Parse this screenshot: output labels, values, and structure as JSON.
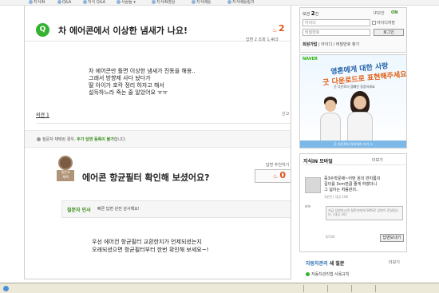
{
  "topnav": {
    "items": [
      "지식iN",
      "Q&A",
      "지식 Q&A",
      "사람들 ▾",
      "지식iN영상",
      "지식배틀",
      "지식배틀링크"
    ]
  },
  "question": {
    "badge": "Q",
    "title": "차 에어콘에서 이상한 냄새가 나요!",
    "score": "2",
    "stats": "답변 2   조회 1,403",
    "body": [
      "차 에어콘만 틀면 이상한 냄새가 진동을 해용..",
      "그래서 방향제 사다 놨다가",
      "딸 아이가 호칵 정리 하자고 해서",
      "설득하느라 죽는 줄 알았어요 ㅠㅠ"
    ],
    "opinion_link": "의견 1",
    "report_link": "신고",
    "notice_text": "질문자 채택된 경우,",
    "notice_bold": "추가 답변 등록이 불가",
    "notice_end": "합니다."
  },
  "answer": {
    "medal_label": "질문자\n채택",
    "title": "에어콘 항균필터 확인해 보셨어요?",
    "rec_label": "답변 추천하기",
    "rec_count": "0",
    "thanks_label": "질문자 인사",
    "thanks_text": "빠른 답변 완전 감사해요!",
    "body": [
      "우선 에어컨 항균필터 교환한지가 언제되셨는지",
      "오래되셨으면 항균필터부터 한번 확인해 보세요~!"
    ]
  },
  "login": {
    "stats_prefix": "보관",
    "stats_count": "2",
    "stats_unit": "건",
    "ip_label": "IP보안",
    "ip_state": "ON",
    "id_placeholder": "아이디",
    "pw_placeholder": "비밀번호",
    "save_id": "아이디저장",
    "login_button": "로그인",
    "join": "회원가입",
    "find": "아이디 / 비밀번호 찾기"
  },
  "ad": {
    "logo": "NAVER",
    "line1": "영혼에게 대한 사랑",
    "line2": "굿 다운로드로 표현해주세요",
    "sub": "굿 다운로더 캠페인 동참하세요",
    "footer": "굿 다운로더 약속하러 가기 >"
  },
  "iq": {
    "title": "지식iN 모바일",
    "more": "더보기",
    "question_lines": [
      "중3수학문제~어떤 원의 반지름의",
      "길이를 3cm만큼 줄게 하였더니",
      "그 넓이는 처음원의.."
    ],
    "meta": "1분전 | 내공 100",
    "user": "바보",
    "answer_placeholder": "지금 답변하시면 질문자에게 SMS로 답변이 전달됩니다. (내공 10)",
    "count": "0/150",
    "submit": "답변보내기"
  },
  "category": {
    "title_blue": "자동차관리",
    "title_rest": "새 질문",
    "more": "더보기",
    "item": "자동차관리법·사용규칙"
  },
  "colors": {
    "accent_green": "#35b232",
    "score_orange": "#e0521d",
    "link_blue": "#2b6db3"
  }
}
